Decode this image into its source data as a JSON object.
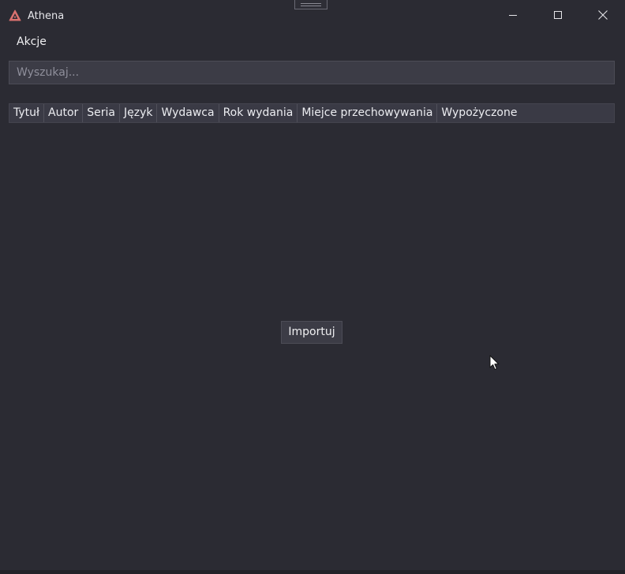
{
  "window": {
    "title": "Athena",
    "icon": "triangle-warning-icon",
    "accent": "#d9716f"
  },
  "menu": {
    "akcje_label": "Akcje"
  },
  "search": {
    "placeholder": "Wyszukaj..."
  },
  "table": {
    "columns": [
      "Tytuł",
      "Autor",
      "Seria",
      "Język",
      "Wydawca",
      "Rok wydania",
      "Miejce przechowywania",
      "Wypożyczone"
    ]
  },
  "actions": {
    "import_label": "Importuj"
  },
  "colors": {
    "background": "#2b2b33",
    "input_background": "#3c3c46",
    "header_background": "#3a3a45",
    "text": "#e6e6ea"
  }
}
